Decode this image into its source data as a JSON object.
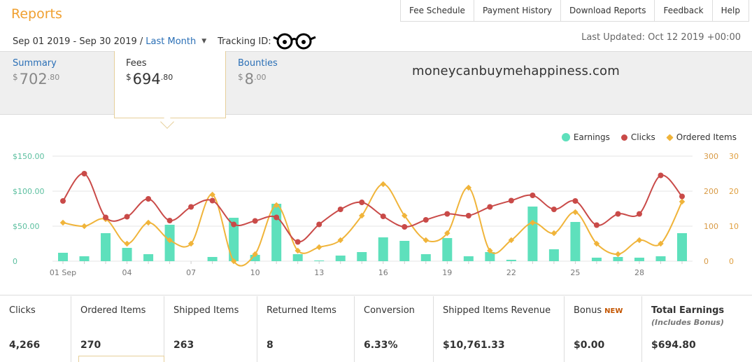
{
  "header": {
    "title": "Reports",
    "nav": [
      "Fee Schedule",
      "Payment History",
      "Download Reports",
      "Feedback",
      "Help"
    ],
    "date_range": "Sep 01 2019 - Sep 30 2019 /",
    "period_link": "Last Month",
    "tracking_label": "Tracking ID:",
    "last_updated": "Last Updated: Oct 12 2019 +00:00"
  },
  "summary": {
    "summary": {
      "label": "Summary",
      "currency": "$",
      "whole": "702",
      "cents": ".80"
    },
    "fees": {
      "label": "Fees",
      "currency": "$",
      "whole": "694",
      "cents": ".80"
    },
    "bounties": {
      "label": "Bounties",
      "currency": "$",
      "whole": "8",
      "cents": ".00"
    }
  },
  "watermark": "moneycanbuymehappiness.com",
  "legend": {
    "earnings": "Earnings",
    "clicks": "Clicks",
    "ordered_items": "Ordered Items"
  },
  "colors": {
    "earnings": "#5ee0bc",
    "clicks": "#c94a48",
    "ordered_items": "#f0b43a",
    "brand": "#f0a030",
    "link": "#2a6fb6"
  },
  "chart_data": {
    "type": "line",
    "x": [
      "01 Sep",
      "02",
      "03",
      "04",
      "05",
      "06",
      "07",
      "08",
      "09",
      "10",
      "11",
      "12",
      "13",
      "14",
      "15",
      "16",
      "17",
      "18",
      "19",
      "20",
      "21",
      "22",
      "23",
      "24",
      "25",
      "26",
      "27",
      "28",
      "29",
      "30"
    ],
    "x_tick_labels": [
      "01 Sep",
      "04",
      "07",
      "10",
      "13",
      "16",
      "19",
      "22",
      "25",
      "28"
    ],
    "left_axis": {
      "ticks": [
        "$150.00",
        "$100.00",
        "$50.00",
        "0"
      ],
      "ylim": [
        0,
        150
      ]
    },
    "right_axis_1": {
      "ticks": [
        "300",
        "200",
        "100",
        "0"
      ],
      "ylim": [
        0,
        300
      ]
    },
    "right_axis_2": {
      "ticks": [
        "30",
        "20",
        "10",
        "0"
      ],
      "ylim": [
        0,
        30
      ]
    },
    "series": [
      {
        "name": "Earnings",
        "kind": "bar",
        "axis": "left",
        "values": [
          12,
          7,
          40,
          19,
          10,
          52,
          0,
          6,
          62,
          9,
          82,
          10,
          1,
          8,
          13,
          34,
          29,
          10,
          33,
          7,
          13,
          2,
          78,
          17,
          56,
          5,
          6,
          5,
          7,
          40
        ]
      },
      {
        "name": "Clicks",
        "kind": "line",
        "axis": "right_1",
        "values": [
          172,
          250,
          125,
          127,
          178,
          116,
          155,
          173,
          105,
          115,
          125,
          55,
          105,
          148,
          168,
          128,
          98,
          118,
          135,
          130,
          155,
          173,
          188,
          148,
          172,
          103,
          135,
          135,
          245,
          185
        ]
      },
      {
        "name": "Ordered Items",
        "kind": "line",
        "axis": "right_2",
        "values": [
          11,
          10,
          12,
          5,
          11,
          6,
          5,
          19,
          0,
          2,
          16,
          3,
          4,
          6,
          13,
          22,
          13,
          6,
          8,
          21,
          3,
          6,
          11,
          8,
          14,
          5,
          2,
          6,
          5,
          17
        ]
      }
    ]
  },
  "metrics": [
    {
      "label": "Clicks",
      "value": "4,266"
    },
    {
      "label": "Ordered Items",
      "value": "270"
    },
    {
      "label": "Shipped Items",
      "value": "263"
    },
    {
      "label": "Returned Items",
      "value": "8"
    },
    {
      "label": "Conversion",
      "value": "6.33%"
    },
    {
      "label": "Shipped Items Revenue",
      "value": "$10,761.33"
    },
    {
      "label": "Bonus",
      "badge": "NEW",
      "value": "$0.00"
    },
    {
      "label": "Total Earnings",
      "sub": "(Includes Bonus)",
      "value": "$694.80"
    }
  ]
}
